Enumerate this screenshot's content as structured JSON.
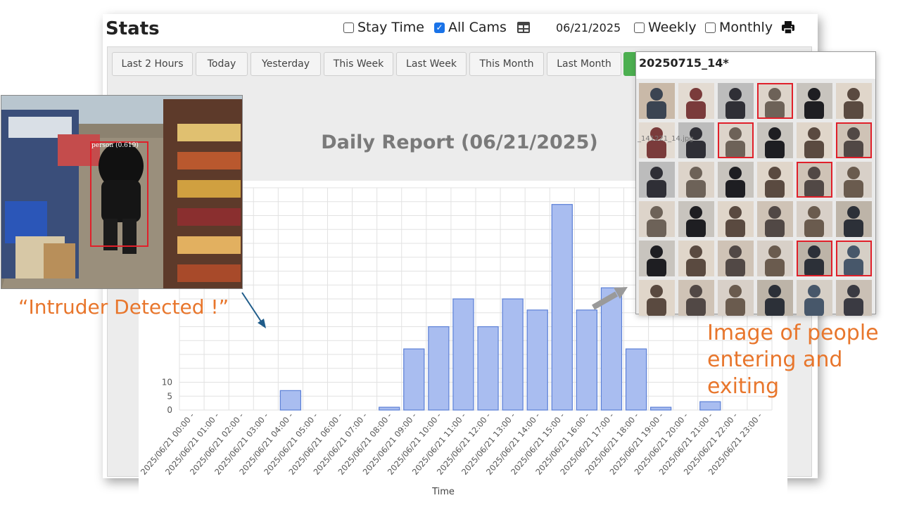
{
  "header": {
    "title": "Stats",
    "stay_time_label": "Stay Time",
    "all_cams_label": "All Cams",
    "date": "06/21/2025",
    "weekly_label": "Weekly",
    "monthly_label": "Monthly",
    "stay_time_checked": false,
    "all_cams_checked": true,
    "weekly_checked": false,
    "monthly_checked": false
  },
  "tabs": [
    "Last 2 Hours",
    "Today",
    "Yesterday",
    "This Week",
    "Last Week",
    "This Month",
    "Last Month"
  ],
  "report_title": "Daily Report (06/21/2025)",
  "chart_data": {
    "type": "bar",
    "xlabel": "Time",
    "ylabel": "",
    "categories": [
      "2025/06/21 00:00 -",
      "2025/06/21 01:00 -",
      "2025/06/21 02:00 -",
      "2025/06/21 03:00 -",
      "2025/06/21 04:00 -",
      "2025/06/21 05:00 -",
      "2025/06/21 06:00 -",
      "2025/06/21 07:00 -",
      "2025/06/21 08:00 -",
      "2025/06/21 09:00 -",
      "2025/06/21 10:00 -",
      "2025/06/21 11:00 -",
      "2025/06/21 12:00 -",
      "2025/06/21 13:00 -",
      "2025/06/21 14:00 -",
      "2025/06/21 15:00 -",
      "2025/06/21 16:00 -",
      "2025/06/21 17:00 -",
      "2025/06/21 18:00 -",
      "2025/06/21 19:00 -",
      "2025/06/21 20:00 -",
      "2025/06/21 21:00 -",
      "2025/06/21 22:00 -",
      "2025/06/21 23:00 -"
    ],
    "values": [
      0,
      0,
      0,
      0,
      7,
      0,
      0,
      0,
      1,
      22,
      30,
      40,
      30,
      40,
      36,
      74,
      36,
      44,
      22,
      1,
      0,
      3,
      0,
      0
    ],
    "yticks": [
      "0",
      "5",
      "10"
    ],
    "ylim": [
      0,
      80
    ],
    "grid": true,
    "bar_color": "#a9bdf0",
    "bar_edge_color": "#5b7fd6"
  },
  "intruder_panel": {
    "detection_label": "person (0.619)",
    "caption": "“Intruder Detected !”"
  },
  "gallery": {
    "title": "20250715_14*",
    "filename_hint": "_141221_14.jpg",
    "caption_line1": "Image of people",
    "caption_line2": "entering and",
    "caption_line3": "exiting",
    "highlighted": [
      3,
      8,
      11,
      16,
      28,
      29
    ]
  },
  "colors": {
    "accent_orange": "#e8762c",
    "highlight_red": "#e0202a",
    "checkbox_blue": "#1a73e8",
    "tab_green": "#4caf50"
  }
}
